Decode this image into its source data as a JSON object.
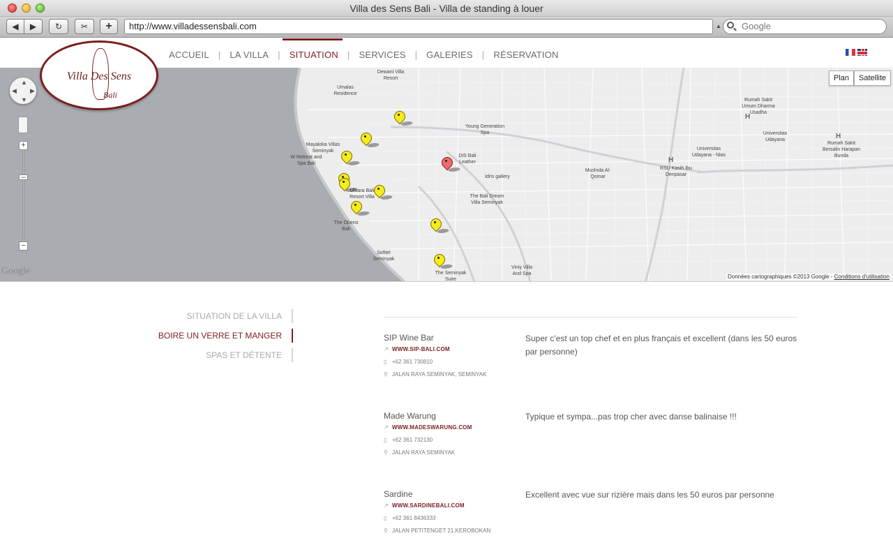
{
  "window": {
    "title": "Villa des Sens Bali - Villa de standing à louer"
  },
  "toolbar": {
    "url": "http://www.villadessensbali.com",
    "search_placeholder": "Google",
    "back": "◀",
    "forward": "▶",
    "reload": "↻",
    "snip": "✂",
    "plus": "+"
  },
  "logo": {
    "title": "Villa Des Sens",
    "subtitle": "Bali"
  },
  "nav": {
    "items": [
      "ACCUEIL",
      "LA VILLA",
      "SITUATION",
      "SERVICES",
      "GALERIES",
      "RÉSERVATION"
    ],
    "separator": "|",
    "active_index": 2
  },
  "map": {
    "buttons": {
      "plan": "Plan",
      "satellite": "Satellite"
    },
    "watermark": "Google",
    "attribution": "Données cartographiques ©2013 Google - ",
    "terms": "Conditions d'utilisation",
    "zoom_plus": "+",
    "zoom_minus": "−",
    "pois": [
      "Dewani Villa Resort",
      "Umalas Residence",
      "Young Generation Spa",
      "DiS Bali Leather",
      "Idris gallery",
      "Mayaloka Villas Seminyak",
      "W Retreat and Spa Bali",
      "Uluara Bali Resort Villa",
      "The Bali Dream Villa Seminyak",
      "The Oberoi Bali",
      "Mushola Al-Qomar",
      "Sofitel Seminyak",
      "The Seminyak Suite",
      "Viniy Villa And Spa",
      "Rumah Sakit Umum Dharma Usadha",
      "Universitas Udayana",
      "Universitas Udayana - Nias",
      "RSU Kasih Ibu Denpasar",
      "Rumah Sakit Bersalin Harapan Bunda",
      "H",
      "H",
      "H"
    ]
  },
  "sidebar": {
    "items": [
      "SITUATION DE LA VILLA",
      "BOIRE UN VERRE ET MANGER",
      "SPAS ET DÉTENTE"
    ],
    "active_index": 1
  },
  "entries": [
    {
      "name": "SIP Wine Bar",
      "link": "WWW.SIP-BALI.COM",
      "phone": "+62 361 730810",
      "address": "JALAN RAYA SEMINYAK, SEMINYAK",
      "description": "Super c'est un top chef et en plus français et excellent  (dans les 50 euros par personne)"
    },
    {
      "name": "Made Warung",
      "link": "WWW.MADESWARUNG.COM",
      "phone": "+62 361 732130",
      "address": "JALAN RAYA SEMINYAK",
      "description": "Typique et sympa...pas trop cher avec danse balinaise !!!"
    },
    {
      "name": "Sardine",
      "link": "WWW.SARDINEBALI.COM",
      "phone": "+62 361 8436333",
      "address": "JALAN PETITENGET 21,KEROBOKAN",
      "description": "Excellent avec vue sur rizière mais dans les 50 euros par personne"
    }
  ],
  "icons": {
    "link": "external-link-icon",
    "phone": "phone-icon",
    "address": "map-marker-icon"
  },
  "colors": {
    "accent": "#7a1f1f",
    "text": "#555555",
    "muted": "#aaaaaa"
  }
}
